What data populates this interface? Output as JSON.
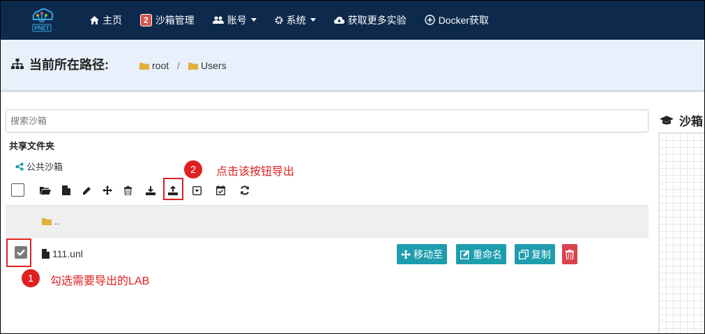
{
  "navbar": {
    "logo_text": "PNET",
    "items": [
      {
        "label": "主页",
        "icon": "home-icon"
      },
      {
        "label": "沙箱管理",
        "badge": "2"
      },
      {
        "label": "账号",
        "icon": "users-icon",
        "dropdown": true
      },
      {
        "label": "系统",
        "icon": "gear-icon",
        "dropdown": true
      },
      {
        "label": "获取更多实验",
        "icon": "cloud-download-icon"
      },
      {
        "label": "Docker获取",
        "icon": "plus-circle-icon"
      }
    ]
  },
  "path": {
    "title": "当前所在路径:",
    "crumbs": [
      "root",
      "Users"
    ],
    "separator": "/"
  },
  "search": {
    "placeholder": "搜索沙箱"
  },
  "shared": {
    "title": "共享文件夹",
    "item": "公共沙箱"
  },
  "toolbar": {
    "icons": [
      "open-folder-icon",
      "new-file-icon",
      "edit-icon",
      "move-icon",
      "delete-icon",
      "import-icon",
      "export-icon",
      "collapse-icon",
      "calendar-check-icon",
      "refresh-icon"
    ]
  },
  "list": {
    "parent_label": "..",
    "file": {
      "name": "111.unl",
      "checked": true,
      "actions": {
        "move": "移动至",
        "rename": "重命名",
        "copy": "复制"
      }
    }
  },
  "annotations": {
    "step1_number": "1",
    "step1_text": "勾选需要导出的LAB",
    "step2_number": "2",
    "step2_text": "点击该按钮导出",
    "highlight_color": "#e02020"
  },
  "right_panel": {
    "title": "沙箱"
  },
  "colors": {
    "navbar": "#0d2a4d",
    "path_bg": "#e8f1fb",
    "action_teal": "#1d9dae",
    "action_red": "#d9414f",
    "folder": "#e0b23c"
  }
}
